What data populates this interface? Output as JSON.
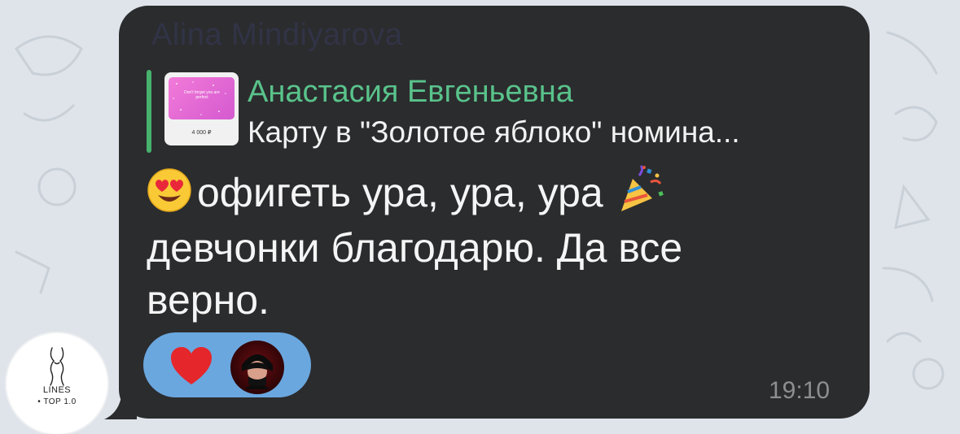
{
  "chat": {
    "sender_name": "Alina Mindiyarova",
    "reply": {
      "author": "Анастасия Евгеньевна",
      "preview_text": "Карту в \"Золотое яблоко\" номина...",
      "thumbnail": {
        "card_text": "Don't forget you are perfect",
        "price": "4 000 ₽"
      }
    },
    "message": {
      "line1_emoji": "smiling-face-with-heart-eyes",
      "line1": "офигеть ура, ура, ура",
      "line1_trailing_emoji": "party-popper",
      "line2": "девчонки благодарю. Да все",
      "line3": "верно."
    },
    "reactions": [
      {
        "type": "heart",
        "color": "#e5262b"
      },
      {
        "type": "user-avatar"
      }
    ],
    "time": "19:10"
  },
  "watermark": {
    "line1": "LINES",
    "line2": "• TOP 1.0"
  },
  "colors": {
    "bubble": "#2b2c2e",
    "reply_accent": "#46b26e",
    "reply_author": "#59c38b",
    "reaction_pill": "#6aa7df",
    "chat_background": "#dfe4ea"
  }
}
